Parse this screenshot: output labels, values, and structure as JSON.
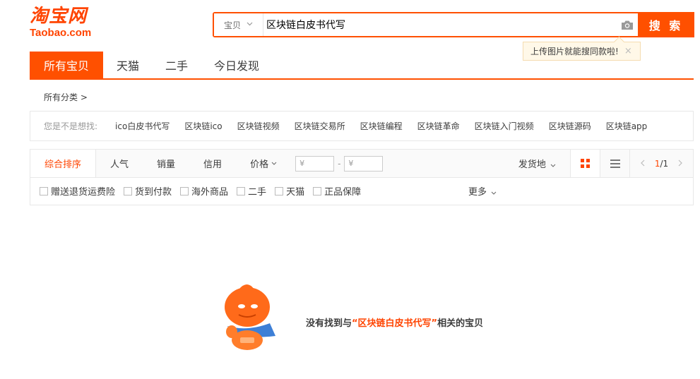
{
  "logo": {
    "cn": "淘宝网",
    "en": "Taobao.com"
  },
  "search": {
    "type_label": "宝贝",
    "query": "区块链白皮书代写",
    "button_label": "搜 索",
    "tip_text": "上传图片就能搜同款啦!",
    "tip_close": "×"
  },
  "tabs": [
    {
      "label": "所有宝贝",
      "active": true
    },
    {
      "label": "天猫"
    },
    {
      "label": "二手"
    },
    {
      "label": "今日发现"
    }
  ],
  "all_categories": "所有分类 >",
  "suggest": {
    "label": "您是不是想找:",
    "keywords": [
      "ico白皮书代写",
      "区块链ico",
      "区块链视频",
      "区块链交易所",
      "区块链编程",
      "区块链革命",
      "区块链入门视频",
      "区块链源码",
      "区块链app"
    ]
  },
  "sort": {
    "items": [
      "综合排序",
      "人气",
      "销量",
      "信用",
      "价格"
    ],
    "price_from_placeholder": "¥",
    "price_to_placeholder": "¥",
    "location": "发货地",
    "page": "1",
    "page_total": "/1"
  },
  "filters": [
    "赠送退货运费险",
    "货到付款",
    "海外商品",
    "二手",
    "天猫",
    "正品保障"
  ],
  "more_label": "更多",
  "empty": {
    "prefix": "没有找到与",
    "keyword": "“区块链白皮书代写”",
    "suffix": "相关的宝贝"
  },
  "colors": {
    "accent": "#ff5000",
    "accent_text": "#ff4400"
  }
}
